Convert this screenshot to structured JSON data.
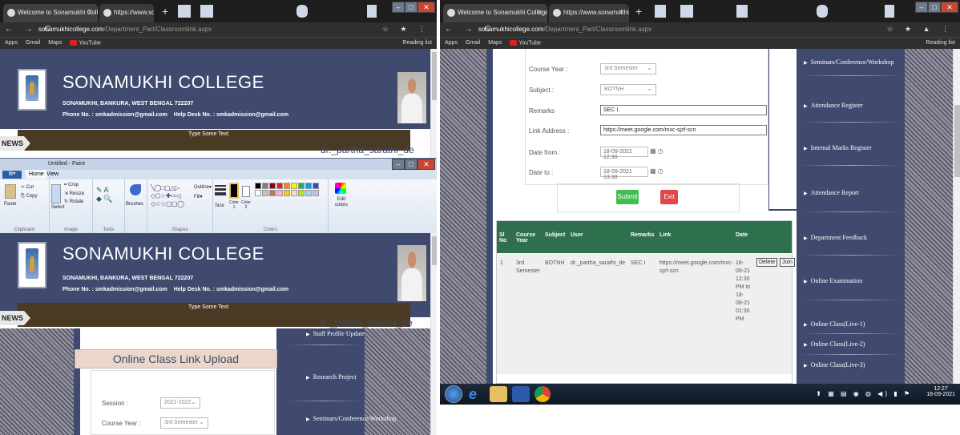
{
  "browser": {
    "tab1": "Welcome to Sonamukhi College",
    "tab2": "https://www.sonamukhicollege.",
    "url_domain": "sonamukhicollege.com",
    "url_path": "/Department_Part/Classroomlink.aspx",
    "bookmarks": [
      "Apps",
      "Gmail",
      "Maps",
      "YouTube"
    ],
    "reading_list": "Reading list",
    "new_tab": "+"
  },
  "college": {
    "name": "SONAMUKHI COLLEGE",
    "address": "SONAMUKHI, BANKURA, WEST BENGAL 722207",
    "phone": "Phone No. : smkadmission@gmail.com",
    "helpdesk": "Help Desk No. : smkadmission@gmail.com",
    "news_label": "NEWS",
    "news_text": "Type Some Text",
    "user": "dr._partha_sarathi_de"
  },
  "paint": {
    "title": "Untitled - Paint",
    "tabs": [
      "Home",
      "View"
    ],
    "groups": [
      "Clipboard",
      "Image",
      "Tools",
      "Shapes",
      "Colors"
    ],
    "clipboard": [
      "Cut",
      "Copy",
      "Paste"
    ],
    "image": [
      "Crop",
      "Resize",
      "Rotate",
      "Select"
    ],
    "brushes": "Brushes",
    "size": "Size",
    "color1": "Color 1",
    "color2": "Color 2",
    "edit_colors": "Edit colors",
    "outline": "Outline",
    "fill": "Fill"
  },
  "left_form": {
    "title": "Online Class Link Upload",
    "session_label": "Session :",
    "session_value": "2021-2022",
    "course_label": "Course Year :",
    "course_value": "3rd Semester"
  },
  "left_menu": [
    "Staff Profile Update",
    "Research Project",
    "Seminars/Conference/Workshop"
  ],
  "right_form": {
    "course_label": "Course Year :",
    "course_value": "3rd Semester",
    "subject_label": "Subject :",
    "subject_value": "BOTNH",
    "remarks_label": "Remarks",
    "remarks_value": "SEC I",
    "link_label": "Link Address :",
    "link_value": "https://meet.google.com/mxc-sjzf-scn",
    "from_label": "Date from :",
    "from_value": "18-09-2021 12:30",
    "to_label": "Date to :",
    "to_value": "18-09-2021 13:30",
    "submit": "Submit",
    "exit": "Exit"
  },
  "table": {
    "headers": [
      "Sl No",
      "Course Year",
      "Subject",
      "User",
      "Remarks",
      "Link",
      "Date"
    ],
    "row": {
      "sl": "1",
      "course": "3rd Semester",
      "subject": "BOTNH",
      "user": "dr._partha_sarathi_de",
      "remarks": "SEC I",
      "link": "https://meet.google.com/mxc-sjzf-scn",
      "date": "18-09-21 12:30 PM to 18-09-21 01:30 PM",
      "delete": "Delete",
      "join": "Join"
    }
  },
  "right_menu": [
    "Seminars/Conference/Workshop",
    "Attendance Register",
    "Internal Marks Register",
    "Attendance Report",
    "Department Feedback",
    "Online Examination",
    "Online Class(Live-1)",
    "Online Class(Live-2)",
    "Online Class(Live-3)"
  ],
  "taskbar": {
    "time": "12:27",
    "date": "18-09-2021"
  }
}
